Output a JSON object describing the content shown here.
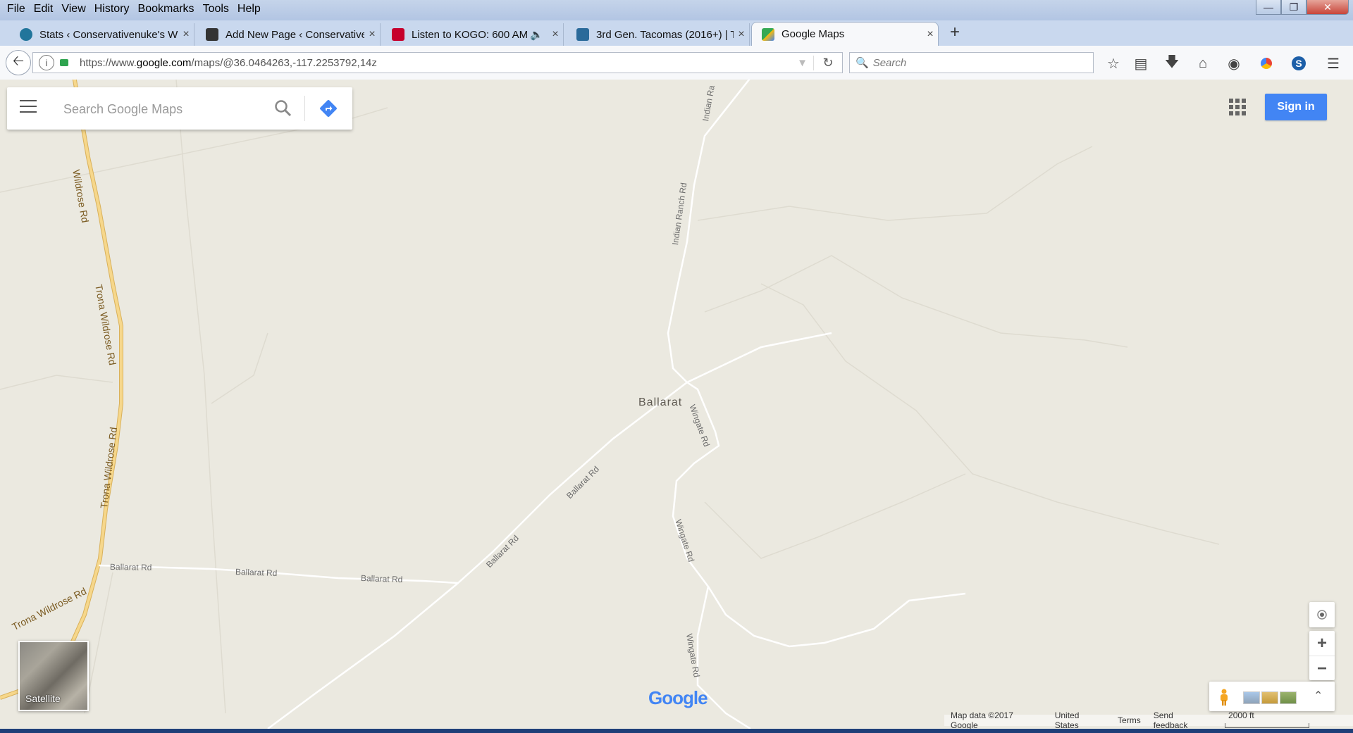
{
  "menu": [
    "File",
    "Edit",
    "View",
    "History",
    "Bookmarks",
    "Tools",
    "Help"
  ],
  "window_controls": {
    "minimize": "minimize-icon",
    "restore": "restore-icon",
    "close": "close-icon"
  },
  "tabs": [
    {
      "title": "Stats ‹ Conservativenuke's W",
      "icon": "wordpress-icon",
      "color": "#21759b"
    },
    {
      "title": "Add New Page ‹ Conservative",
      "icon": "site-icon",
      "color": "#333333"
    },
    {
      "title": "Listen to KOGO: 600 AM",
      "icon": "iheart-icon",
      "color": "#c6002b",
      "audio": "speaker-icon"
    },
    {
      "title": "3rd Gen. Tacomas (2016+) | T",
      "icon": "forum-icon",
      "color": "#2a6a9a"
    },
    {
      "title": "Google Maps",
      "icon": "google-maps-icon",
      "color": "#34a853",
      "active": true
    }
  ],
  "address": {
    "prefix": "https://www.",
    "host": "google.com",
    "path": "/maps/@36.0464263,-117.2253792,14z"
  },
  "browser_search_placeholder": "Search",
  "toolbar_icons": [
    "bookmark-star-icon",
    "reading-list-icon",
    "download-icon",
    "home-icon",
    "pocket-icon",
    "extension-icon",
    "skype-icon",
    "menu-icon"
  ],
  "maps": {
    "search_placeholder": "Search Google Maps",
    "sign_in": "Sign in",
    "satellite_label": "Satellite",
    "place": "Ballarat",
    "road_labels": {
      "indian_ra": "Indian Ra",
      "indian_ranch": "Indian Ranch Rd",
      "wildrose_top": "Wildrose Rd",
      "trona_wildrose_1": "Trona Wildrose Rd",
      "trona_wildrose_2": "Trona Wildrose Rd",
      "trona_wildrose_3": "Trona Wildrose Rd",
      "wingate_1": "Wingate Rd",
      "wingate_2": "Wingate Rd",
      "wingate_3": "Wingate Rd",
      "ballarat_1": "Ballarat Rd",
      "ballarat_2": "Ballarat Rd",
      "ballarat_3": "Ballarat Rd",
      "ballarat_4": "Ballarat Rd",
      "ballarat_5": "Ballarat Rd"
    },
    "logo": "Google",
    "attribution": {
      "data": "Map data ©2017 Google",
      "region": "United States",
      "terms": "Terms",
      "feedback": "Send feedback",
      "scale": "2000 ft"
    },
    "colors": {
      "background": "#ebe9e0",
      "highway": "#f6d78b",
      "road": "#ffffff",
      "accent": "#4285f4"
    }
  }
}
